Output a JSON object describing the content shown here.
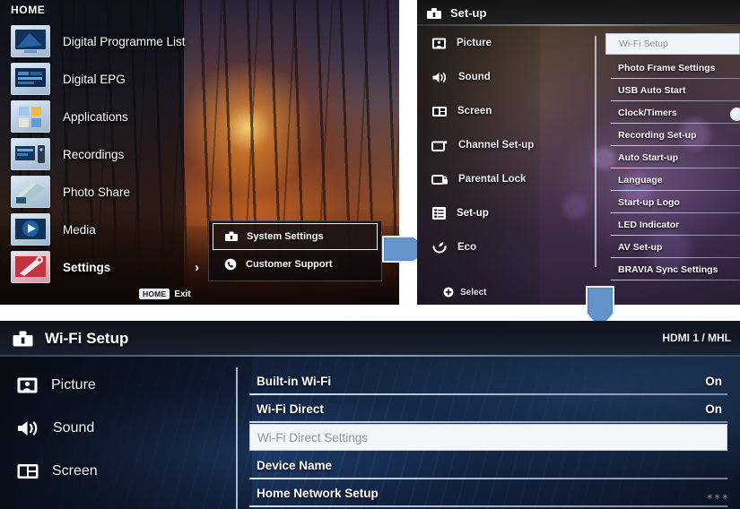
{
  "home_panel": {
    "title": "HOME",
    "items": [
      {
        "label": "Digital Programme List",
        "icon": "tv-programme-icon"
      },
      {
        "label": "Digital EPG",
        "icon": "epg-guide-icon"
      },
      {
        "label": "Applications",
        "icon": "applications-icon"
      },
      {
        "label": "Recordings",
        "icon": "recordings-icon"
      },
      {
        "label": "Photo Share",
        "icon": "photo-share-icon"
      },
      {
        "label": "Media",
        "icon": "media-play-icon"
      },
      {
        "label": "Settings",
        "icon": "settings-wrench-icon"
      }
    ],
    "selected_item": "Settings",
    "chevron": "›",
    "footer": {
      "key": "HOME",
      "action": "Exit"
    },
    "submenu": {
      "items": [
        {
          "label": "System Settings",
          "icon": "toolbox-icon",
          "selected": true
        },
        {
          "label": "Customer Support",
          "icon": "phone-icon",
          "selected": false
        }
      ]
    }
  },
  "setup_panel": {
    "title": "Set-up",
    "title_icon": "toolbox-icon",
    "sidebar": [
      {
        "label": "Picture",
        "icon": "picture-icon"
      },
      {
        "label": "Sound",
        "icon": "speaker-icon"
      },
      {
        "label": "Screen",
        "icon": "screen-icon"
      },
      {
        "label": "Channel Set-up",
        "icon": "channel-icon"
      },
      {
        "label": "Parental Lock",
        "icon": "parental-lock-icon"
      },
      {
        "label": "Set-up",
        "icon": "setup-list-icon"
      },
      {
        "label": "Eco",
        "icon": "eco-leaf-icon"
      }
    ],
    "selected_sidebar": "Set-up",
    "select_hint": {
      "label": "Select",
      "icon": "select-plus-icon"
    },
    "menu": [
      {
        "label": "Wi-Fi Setup",
        "selected": true
      },
      {
        "label": "Photo Frame Settings",
        "selected": false
      },
      {
        "label": "USB Auto Start",
        "selected": false
      },
      {
        "label": "Clock/Timers",
        "selected": false
      },
      {
        "label": "Recording Set-up",
        "selected": false
      },
      {
        "label": "Auto Start-up",
        "selected": false
      },
      {
        "label": "Language",
        "selected": false
      },
      {
        "label": "Start-up Logo",
        "selected": false
      },
      {
        "label": "LED Indicator",
        "selected": false
      },
      {
        "label": "AV Set-up",
        "selected": false
      },
      {
        "label": "BRAVIA Sync Settings",
        "selected": false
      }
    ]
  },
  "wifi_panel": {
    "title": "Wi-Fi Setup",
    "title_icon": "toolbox-icon",
    "source_label": "HDMI 1 / MHL",
    "sidebar": [
      {
        "label": "Picture",
        "icon": "picture-icon"
      },
      {
        "label": "Sound",
        "icon": "speaker-icon"
      },
      {
        "label": "Screen",
        "icon": "screen-icon"
      }
    ],
    "items": [
      {
        "label": "Built-in Wi-Fi",
        "value": "On",
        "selected": false
      },
      {
        "label": "Wi-Fi Direct",
        "value": "On",
        "selected": false
      },
      {
        "label": "Wi-Fi Direct Settings",
        "value": "",
        "selected": true
      },
      {
        "label": "Device Name",
        "value": "",
        "selected": false
      },
      {
        "label": "Home Network Setup",
        "value": "",
        "selected": false
      }
    ],
    "watermark": "∗∗∗"
  },
  "arrows": {
    "right_arrow": "arrow-right-pentagon",
    "down_arrow": "arrow-down-pentagon",
    "color": "#5b8bc4"
  }
}
